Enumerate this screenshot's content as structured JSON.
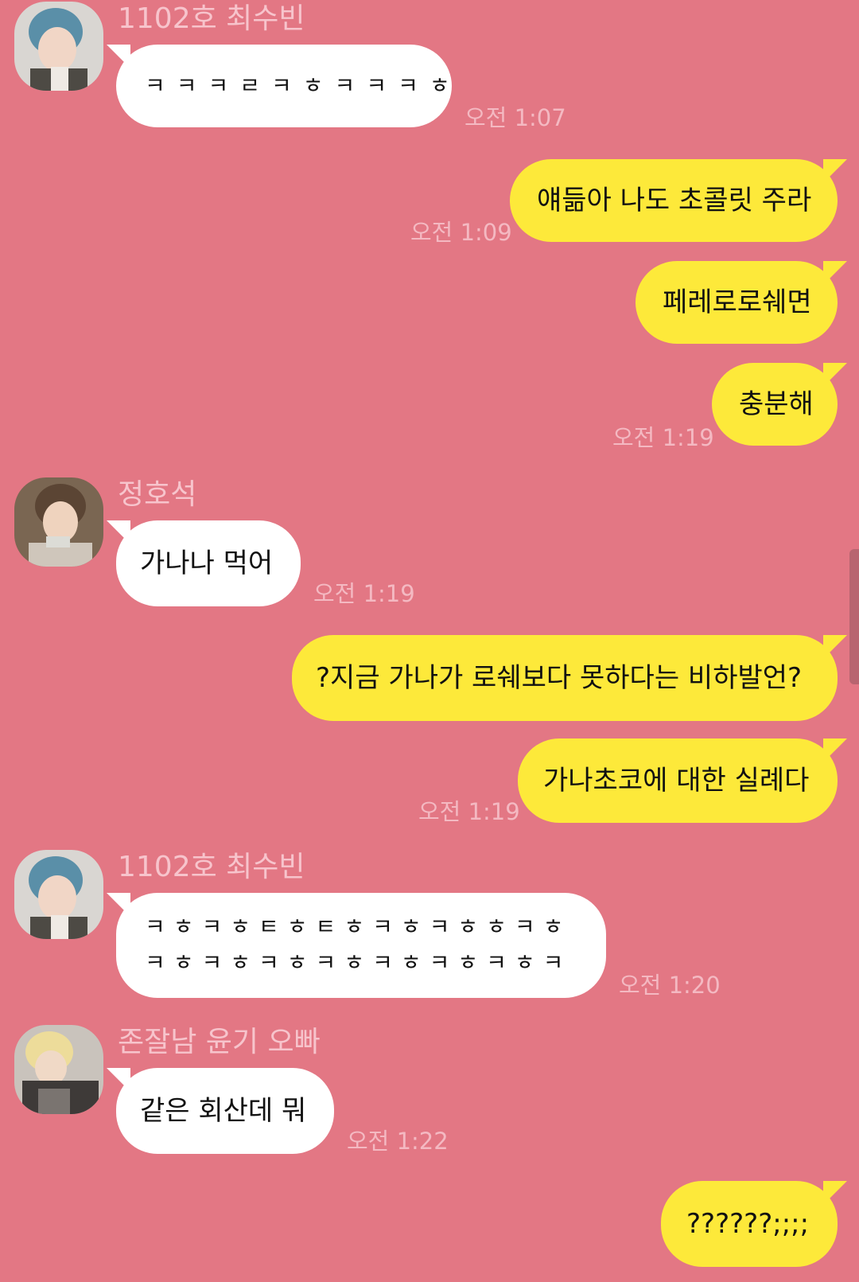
{
  "senders": {
    "soobin": "1102호 최수빈",
    "hoseok": "정호석",
    "yoongi": "존잘남 윤기 오빠"
  },
  "messages": [
    {
      "text": "ㅋㅋㅋㄹㅋㅎㅋㅋㅋㅎ",
      "time": "오전 1:07"
    },
    {
      "text": "얘듦아 나도 초콜릿 주라",
      "time": "오전 1:09"
    },
    {
      "text": "페레로로쉐면"
    },
    {
      "text": "충분해",
      "time": "오전 1:19"
    },
    {
      "text": "가나나 먹어",
      "time": "오전 1:19"
    },
    {
      "text": "?지금 가나가 로쉐보다 못하다는 비하발언?"
    },
    {
      "text": "가나초코에 대한 실례다",
      "time": "오전 1:19"
    },
    {
      "line1": "ㅋㅎㅋㅎㅌㅎㅌㅎㅋㅎㅋㅎㅎㅋㅎ",
      "line2": "ㅋㅎㅋㅎㅋㅎㅋㅎㅋㅎㅋㅎㅋㅎㅋ",
      "time": "오전 1:20"
    },
    {
      "text": "같은 회산데 뭐",
      "time": "오전 1:22"
    },
    {
      "text": "??????;;;;"
    }
  ],
  "colors": {
    "background": "#e37784",
    "incoming_bubble": "#ffffff",
    "outgoing_bubble": "#fde93a"
  }
}
